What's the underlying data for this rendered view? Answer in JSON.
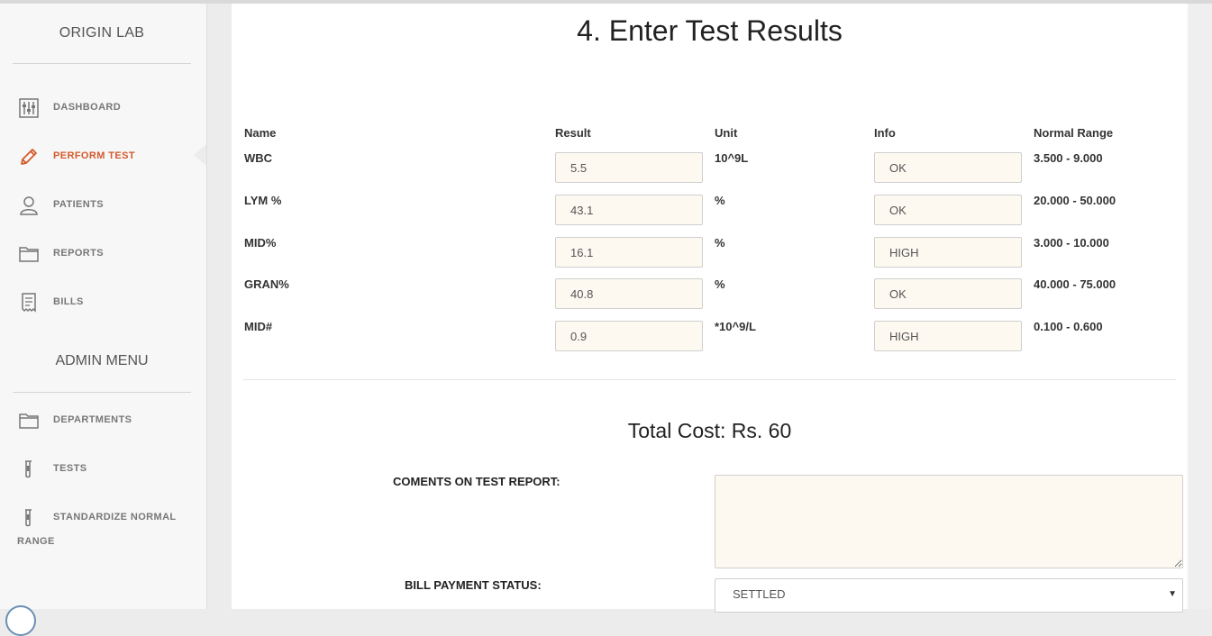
{
  "sidebar": {
    "brand": "ORIGIN LAB",
    "items": [
      {
        "label": "DASHBOARD",
        "icon": "sliders-icon"
      },
      {
        "label": "PERFORM TEST",
        "icon": "pencil-icon",
        "active": true
      },
      {
        "label": "PATIENTS",
        "icon": "user-icon"
      },
      {
        "label": "REPORTS",
        "icon": "folder-icon"
      },
      {
        "label": "BILLS",
        "icon": "receipt-icon"
      }
    ],
    "admin_title": "ADMIN MENU",
    "admin_items": [
      {
        "label": "DEPARTMENTS",
        "icon": "folder-icon"
      },
      {
        "label": "TESTS",
        "icon": "test-tube-icon"
      },
      {
        "label": "STANDARDIZE NORMAL",
        "label2": "RANGE",
        "icon": "test-tube-icon"
      }
    ]
  },
  "main": {
    "title": "4. Enter Test Results",
    "headers": {
      "name": "Name",
      "result": "Result",
      "unit": "Unit",
      "info": "Info",
      "range": "Normal Range"
    },
    "rows": [
      {
        "name": "WBC",
        "result": "5.5",
        "unit": "10^9L",
        "info": "OK",
        "range": "3.500 - 9.000"
      },
      {
        "name": "LYM %",
        "result": "43.1",
        "unit": "%",
        "info": "OK",
        "range": "20.000 - 50.000"
      },
      {
        "name": "MID%",
        "result": "16.1",
        "unit": "%",
        "info": "HIGH",
        "range": "3.000 - 10.000"
      },
      {
        "name": "GRAN%",
        "result": "40.8",
        "unit": "%",
        "info": "OK",
        "range": "40.000 - 75.000"
      },
      {
        "name": "MID#",
        "result": "0.9",
        "unit": "*10^9/L",
        "info": "HIGH",
        "range": "0.100 - 0.600"
      }
    ],
    "total_cost": "Total Cost: Rs. 60",
    "comments_label": "COMENTS ON TEST REPORT:",
    "comments_value": "",
    "payment_label": "BILL PAYMENT STATUS:",
    "payment_value": "SETTLED",
    "payment_caret": "▼"
  },
  "colors": {
    "accent": "#d35a2b",
    "field_bg": "#fdf9f1"
  }
}
